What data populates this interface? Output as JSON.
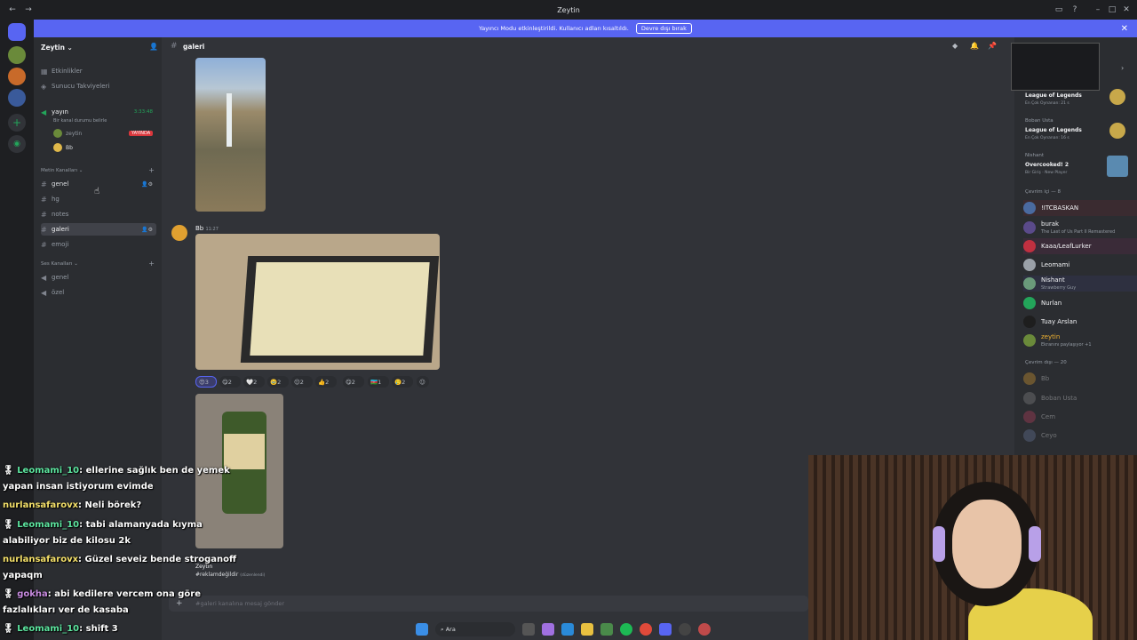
{
  "window": {
    "title": "Zeytin"
  },
  "banner": {
    "text": "Yayıncı Modu etkinleştirildi. Kullanıcı adları kısaltıldı.",
    "button": "Devre dışı bırak"
  },
  "server": {
    "name": "Zeytin",
    "top_items": [
      "Etkinlikler",
      "Sunucu Takviyeleri"
    ],
    "voice_live": {
      "channel": "yayın",
      "status": "Bir kanal durumu belirle",
      "timer": "3:33:48",
      "users": [
        {
          "name": "zeytin",
          "badge": "YAYINDA"
        },
        {
          "name": "Bb"
        }
      ]
    },
    "text_category": "Metin Kanalları",
    "text_channels": [
      "genel",
      "hg",
      "notes",
      "galeri",
      "emoji"
    ],
    "voice_category": "Ses Kanalları",
    "voice_channels": [
      "genel",
      "özel"
    ]
  },
  "channel": {
    "name": "galeri",
    "composer_placeholder": "#galeri kanalına mesaj gönder"
  },
  "messages": {
    "author": "Bb",
    "time": "11:27",
    "reactions": [
      "3",
      "2",
      "2",
      "2",
      "2",
      "2",
      "2",
      "1",
      "2"
    ],
    "last": {
      "author": "Zeytin",
      "text": "#reklamdeğildir",
      "edited": "(düzenlendi)"
    }
  },
  "members": {
    "activity": [
      {
        "game": "League of Legends",
        "meta": "En Çok Oynanan: 21 s"
      },
      {
        "name": "Boban Usta",
        "game": "League of Legends",
        "meta": "En Çok Oynanan: 16 s"
      },
      {
        "name": "Nishant",
        "game": "Overcooked! 2",
        "meta": "Bir Giriş · New Player"
      }
    ],
    "online_header": "Çevrim içi — 8",
    "online": [
      {
        "name": "!ITCBASKAN"
      },
      {
        "name": "burak",
        "sub": "The Last of Us Part II Remastered"
      },
      {
        "name": "Kaaa/LeafLurker"
      },
      {
        "name": "Leomami"
      },
      {
        "name": "Nishant",
        "sub": "Strawberry Guy"
      },
      {
        "name": "Nurlan"
      },
      {
        "name": "Tuay Arslan"
      },
      {
        "name": "zeytin",
        "sub": "Ekranını paylaşıyor +1"
      }
    ],
    "offline_header": "Çevrim dışı — 20",
    "offline": [
      "Bb",
      "Boban Usta",
      "Cem",
      "Ceyo"
    ]
  },
  "chat_overlay": [
    {
      "user": "Leomami_10",
      "text": ": ellerine sağlık ben de yemek"
    },
    {
      "cont": "yapan insan istiyorum evimde"
    },
    {
      "user": "nurlansafarovx",
      "text": ": Neli börek?"
    },
    {
      "user": "Leomami_10",
      "text": ": tabi alamanyada kıyma"
    },
    {
      "cont": "alabiliyor biz de kilosu 2k"
    },
    {
      "user": "nurlansafarovx",
      "text": ": Güzel seveiz bende stroganoff"
    },
    {
      "cont": "yapaqm"
    },
    {
      "user": "gokha",
      "text": ": abi kedilere vercem ona göre"
    },
    {
      "cont": "fazlalıkları ver de kasaba"
    },
    {
      "user": "Leomami_10",
      "text": ": shift 3"
    }
  ],
  "taskbar": {
    "search": "Ara"
  },
  "colors": {
    "accent": "#5865f2",
    "live": "#da373c",
    "online": "#23a55a"
  }
}
